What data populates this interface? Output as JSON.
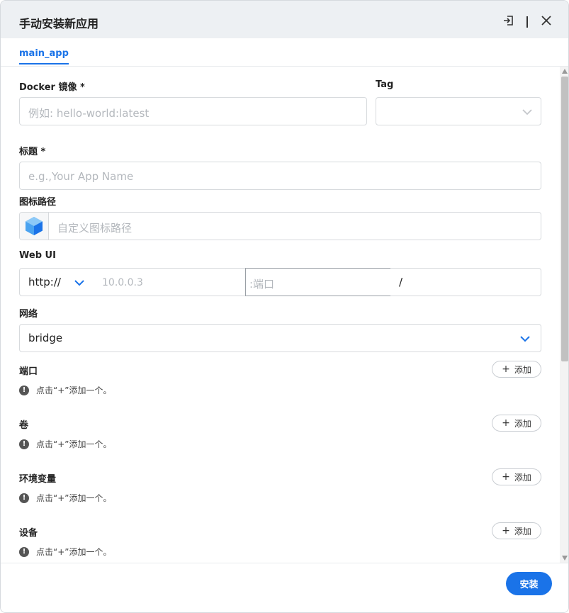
{
  "dialog": {
    "title": "手动安装新应用",
    "tab_label": "main_app"
  },
  "form": {
    "docker_image": {
      "label": "Docker 镜像 *",
      "placeholder": "例如: hello-world:latest"
    },
    "tag": {
      "label": "Tag",
      "value": ""
    },
    "title": {
      "label": "标题 *",
      "placeholder": "e.g.,Your App Name"
    },
    "icon_path": {
      "label": "图标路径",
      "placeholder": "自定义图标路径"
    },
    "web_ui": {
      "label": "Web UI",
      "protocol": "http://",
      "host_placeholder": "10.0.0.3",
      "port_placeholder": ":端口",
      "path_value": "/"
    },
    "network": {
      "label": "网络",
      "value": "bridge"
    },
    "sections": [
      {
        "label": "端口",
        "add_label": "添加",
        "hint": "点击“+”添加一个。"
      },
      {
        "label": "卷",
        "add_label": "添加",
        "hint": "点击“+”添加一个。"
      },
      {
        "label": "环境变量",
        "add_label": "添加",
        "hint": "点击“+”添加一个。"
      },
      {
        "label": "设备",
        "add_label": "添加",
        "hint": "点击“+”添加一个。"
      }
    ]
  },
  "footer": {
    "install_label": "安装"
  },
  "colors": {
    "accent": "#1a73e8",
    "titlebar_bg": "#edf0f3",
    "border": "#d7dadd"
  },
  "icons": {
    "import": "import-icon",
    "close": "close-icon",
    "app_cube": "cube-icon",
    "chevron": "chevron-down-icon",
    "info": "exclamation-circle-icon",
    "plus": "plus-icon"
  }
}
